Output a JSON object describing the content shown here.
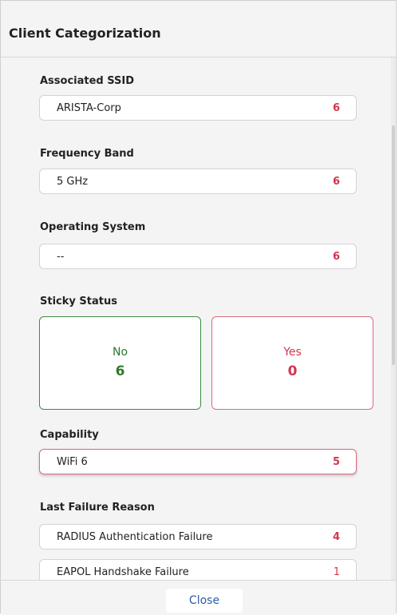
{
  "header": {
    "title": "Client Categorization"
  },
  "sections": {
    "ssid": {
      "title": "Associated SSID",
      "items": [
        {
          "label": "ARISTA-Corp",
          "count": "6"
        }
      ]
    },
    "band": {
      "title": "Frequency Band",
      "items": [
        {
          "label": "5 GHz",
          "count": "6"
        }
      ]
    },
    "os": {
      "title": "Operating System",
      "items": [
        {
          "label": "--",
          "count": "6"
        }
      ]
    },
    "sticky": {
      "title": "Sticky Status",
      "no": {
        "label": "No",
        "value": "6"
      },
      "yes": {
        "label": "Yes",
        "value": "0"
      }
    },
    "capability": {
      "title": "Capability",
      "items": [
        {
          "label": "WiFi 6",
          "count": "5",
          "selected": true
        }
      ]
    },
    "failure": {
      "title": "Last Failure Reason",
      "items": [
        {
          "label": "RADIUS Authentication Failure",
          "count": "4"
        },
        {
          "label": "EAPOL Handshake Failure",
          "count": "1"
        }
      ]
    }
  },
  "footer": {
    "close_label": "Close"
  },
  "colors": {
    "count_red": "#d1364f",
    "sticky_green": "#2c7a2c",
    "close_blue": "#2b5fa8"
  }
}
